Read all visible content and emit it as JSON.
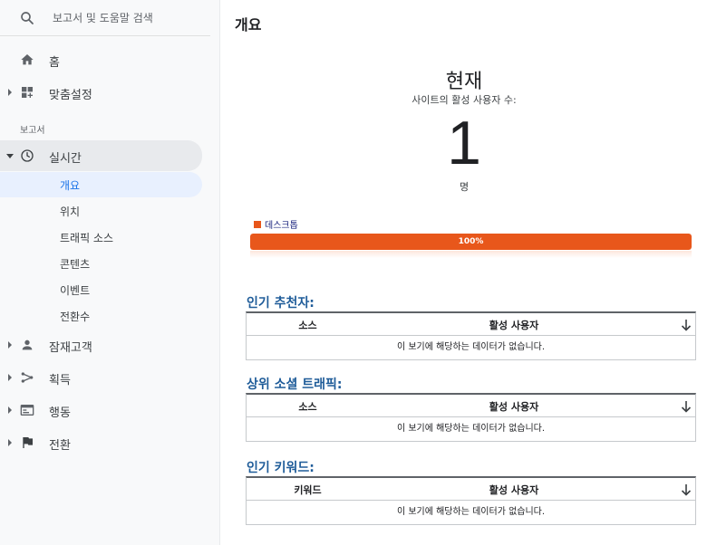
{
  "search": {
    "placeholder": "보고서 및 도움말 검색"
  },
  "nav": {
    "home": "홈",
    "customization": "맞춤설정",
    "reports_section": "보고서",
    "realtime": "실시간",
    "realtime_items": [
      "개요",
      "위치",
      "트래픽 소스",
      "콘텐츠",
      "이벤트",
      "전환수"
    ],
    "audience": "잠재고객",
    "acquisition": "획득",
    "behavior": "행동",
    "conversions": "전환"
  },
  "main": {
    "title": "개요",
    "now_label": "현재",
    "active_caption": "사이트의 활성 사용자 수:",
    "active_count": "1",
    "count_unit": "명",
    "device_legend": "데스크톱",
    "device_percent": "100%",
    "device_fraction": 1.0,
    "accent_color": "#e8571b",
    "tables": [
      {
        "title": "인기 추천자:",
        "col1": "소스",
        "col2": "활성 사용자",
        "empty": "이 보기에 해당하는 데이터가 없습니다."
      },
      {
        "title": "상위 소셜 트래픽:",
        "col1": "소스",
        "col2": "활성 사용자",
        "empty": "이 보기에 해당하는 데이터가 없습니다."
      },
      {
        "title": "인기 키워드:",
        "col1": "키워드",
        "col2": "활성 사용자",
        "empty": "이 보기에 해당하는 데이터가 없습니다."
      }
    ]
  }
}
